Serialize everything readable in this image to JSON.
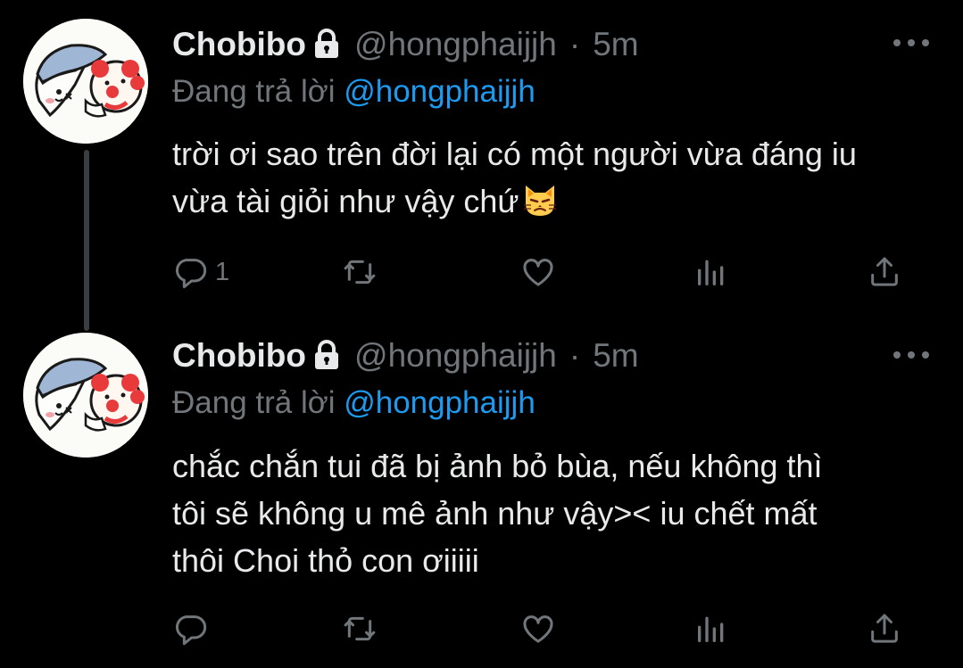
{
  "colors": {
    "background": "#000000",
    "text": "#e7e9ea",
    "muted": "#71767b",
    "link": "#1d9bf0"
  },
  "tweets": [
    {
      "name": "Chobibo",
      "handle": "@hongphaijjh",
      "separator": "·",
      "time": "5m",
      "reply_prefix": "Đang trả lời",
      "reply_to": "@hongphaijjh",
      "line1": "trời ơi sao trên đời lại có một người vừa đáng iu",
      "line2": "vừa tài giỏi như vậy chứ",
      "emoji": "cat-face-icon",
      "reply_count": "1"
    },
    {
      "name": "Chobibo",
      "handle": "@hongphaijjh",
      "separator": "·",
      "time": "5m",
      "reply_prefix": "Đang trả lời",
      "reply_to": "@hongphaijjh",
      "line1": "chắc chắn tui đã bị ảnh bỏ bùa, nếu không thì",
      "line2": "tôi sẽ không u mê ảnh như vậy>< iu chết mất",
      "line3": "thôi Choi thỏ con ơiiiii",
      "reply_count": ""
    }
  ]
}
